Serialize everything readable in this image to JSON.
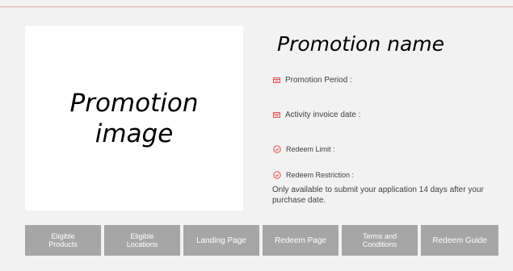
{
  "promotion": {
    "image_placeholder": "Promotion image",
    "name": "Promotion name"
  },
  "details": {
    "period_label": "Promotion Period :",
    "invoice_label": "Activity invoice date :",
    "limit_label": "Redeem Limit :",
    "restriction_label": "Redeem Restriction :",
    "restriction_note": "Only available to submit your application 14 days after your purchase date."
  },
  "buttons": [
    {
      "label": "Eligible\nProducts"
    },
    {
      "label": "Eligible\nLocations"
    },
    {
      "label": "Landing Page"
    },
    {
      "label": "Redeem Page"
    },
    {
      "label": "Terms and\nConditions"
    },
    {
      "label": "Redeem Guide"
    }
  ],
  "icons": {
    "calendar": "calendar-icon",
    "check_circle": "check-circle-icon"
  },
  "colors": {
    "accent": "#e05050",
    "button_bg": "#a6a6a6",
    "page_bg": "#f2f2f2",
    "text": "#404040"
  }
}
